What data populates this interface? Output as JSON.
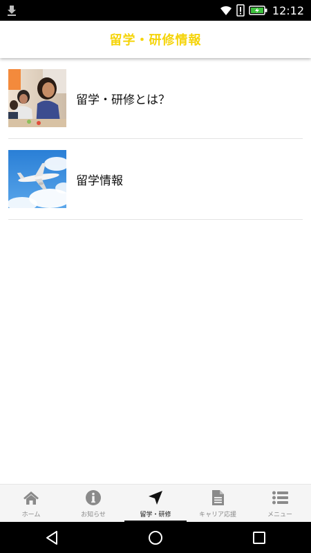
{
  "status": {
    "time": "12:12"
  },
  "header": {
    "title": "留学・研修情報"
  },
  "list": {
    "items": [
      {
        "label": "留学・研修とは？"
      },
      {
        "label": "留学情報"
      }
    ]
  },
  "bottom_nav": {
    "items": [
      {
        "label": "ホーム"
      },
      {
        "label": "お知らせ"
      },
      {
        "label": "留学・研修"
      },
      {
        "label": "キャリア応援"
      },
      {
        "label": "メニュー"
      }
    ],
    "active_index": 2
  },
  "colors": {
    "accent": "#f5d40a",
    "icon_inactive": "#8a8a8a",
    "icon_active": "#111111"
  }
}
